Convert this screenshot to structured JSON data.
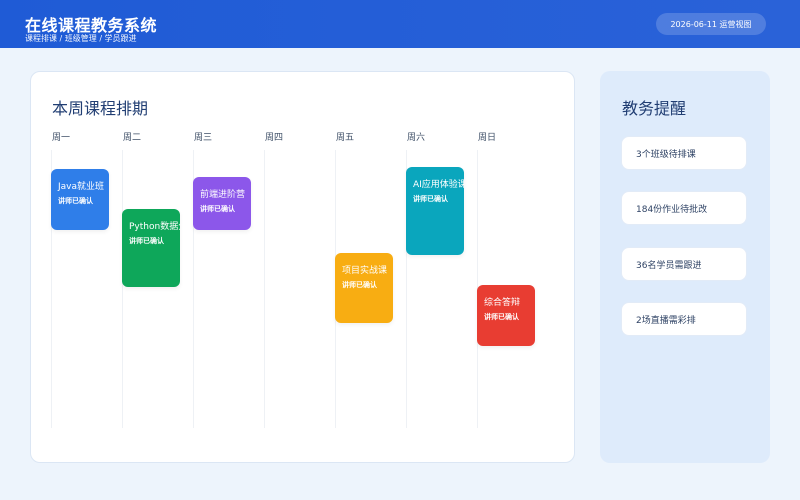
{
  "header": {
    "title": "在线课程教务系统",
    "breadcrumb": "课程排课 / 班级管理 / 学员跟进",
    "date_view": "2026-06-11 运营视图"
  },
  "schedule": {
    "title": "本周课程排期",
    "days": [
      "周一",
      "周二",
      "周三",
      "周四",
      "周五",
      "周六",
      "周日"
    ],
    "courses": [
      {
        "name": "Java就业班",
        "status": "讲师已确认",
        "color": "#2f7ee9"
      },
      {
        "name": "Python数据分",
        "status": "讲师已确认",
        "color": "#0ea75a"
      },
      {
        "name": "前端进阶营",
        "status": "讲师已确认",
        "color": "#8c57ea"
      },
      {
        "name": "项目实战课",
        "status": "讲师已确认",
        "color": "#f8ad12"
      },
      {
        "name": "AI应用体验课",
        "status": "讲师已确认",
        "color": "#0aa6bd"
      },
      {
        "name": "综合答辩",
        "status": "讲师已确认",
        "color": "#e83d32"
      }
    ]
  },
  "reminders": {
    "title": "教务提醒",
    "items": [
      "3个班级待排课",
      "184份作业待批改",
      "36名学员需跟进",
      "2场直播需彩排"
    ]
  }
}
